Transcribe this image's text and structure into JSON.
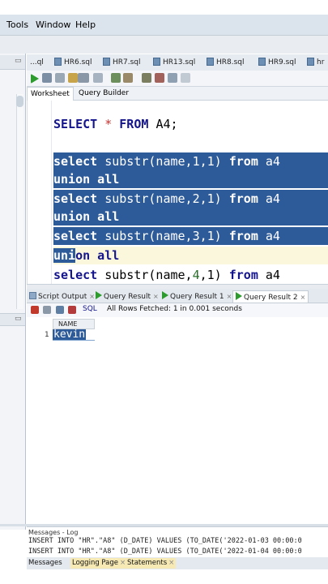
{
  "menu": {
    "tools": "Tools",
    "window": "Window",
    "help": "Help"
  },
  "file_tabs": [
    {
      "label": "...ql"
    },
    {
      "label": "HR6.sql"
    },
    {
      "label": "HR7.sql"
    },
    {
      "label": "HR13.sql"
    },
    {
      "label": "HR8.sql"
    },
    {
      "label": "HR9.sql"
    },
    {
      "label": "hr"
    }
  ],
  "worksheet_tabs": {
    "worksheet": "Worksheet",
    "query_builder": "Query Builder"
  },
  "editor": {
    "line1": {
      "kw1": "SELECT",
      "star": "*",
      "kw2": "FROM",
      "rest": "A4;"
    },
    "selected_lines": [
      {
        "k1": "select",
        "fn": "substr(name,",
        "n": "1",
        "tail": ",1)",
        "k2": "from",
        "t": "a4"
      },
      {
        "union": "union all"
      },
      {
        "k1": "select",
        "fn": "substr(name,",
        "n": "2",
        "tail": ",1)",
        "k2": "from",
        "t": "a4"
      },
      {
        "union": "union all"
      },
      {
        "k1": "select",
        "fn": "substr(name,",
        "n": "3",
        "tail": ",1)",
        "k2": "from",
        "t": "a4"
      },
      {
        "union_a": "uni",
        "union_b": "on all"
      },
      {
        "k1": "select",
        "fn": "substr(name,",
        "n": "4",
        "tail": ",1)",
        "k2": "from",
        "t": "a4"
      }
    ]
  },
  "result_tabs": [
    {
      "label": "Script Output"
    },
    {
      "label": "Query Result"
    },
    {
      "label": "Query Result 1"
    },
    {
      "label": "Query Result 2"
    }
  ],
  "result_toolbar": {
    "sql": "SQL",
    "status": "All Rows Fetched: 1 in 0.001 seconds"
  },
  "grid": {
    "column": "NAME",
    "rownum": "1",
    "value": "kevin"
  },
  "log": {
    "title": "Messages - Log",
    "lines": [
      "INSERT INTO \"HR\".\"A8\" (D_DATE) VALUES (TO_DATE('2022-01-03 00:00:0",
      "INSERT INTO \"HR\".\"A8\" (D_DATE) VALUES (TO_DATE('2022-01-04 00:00:0"
    ],
    "tabs": {
      "messages": "Messages",
      "logging": "Logging Page",
      "statements": "Statements"
    }
  },
  "colors": {
    "selection": "#2d5a98",
    "menubar": "#dbe3ec",
    "run_green": "#2d9b2d"
  }
}
